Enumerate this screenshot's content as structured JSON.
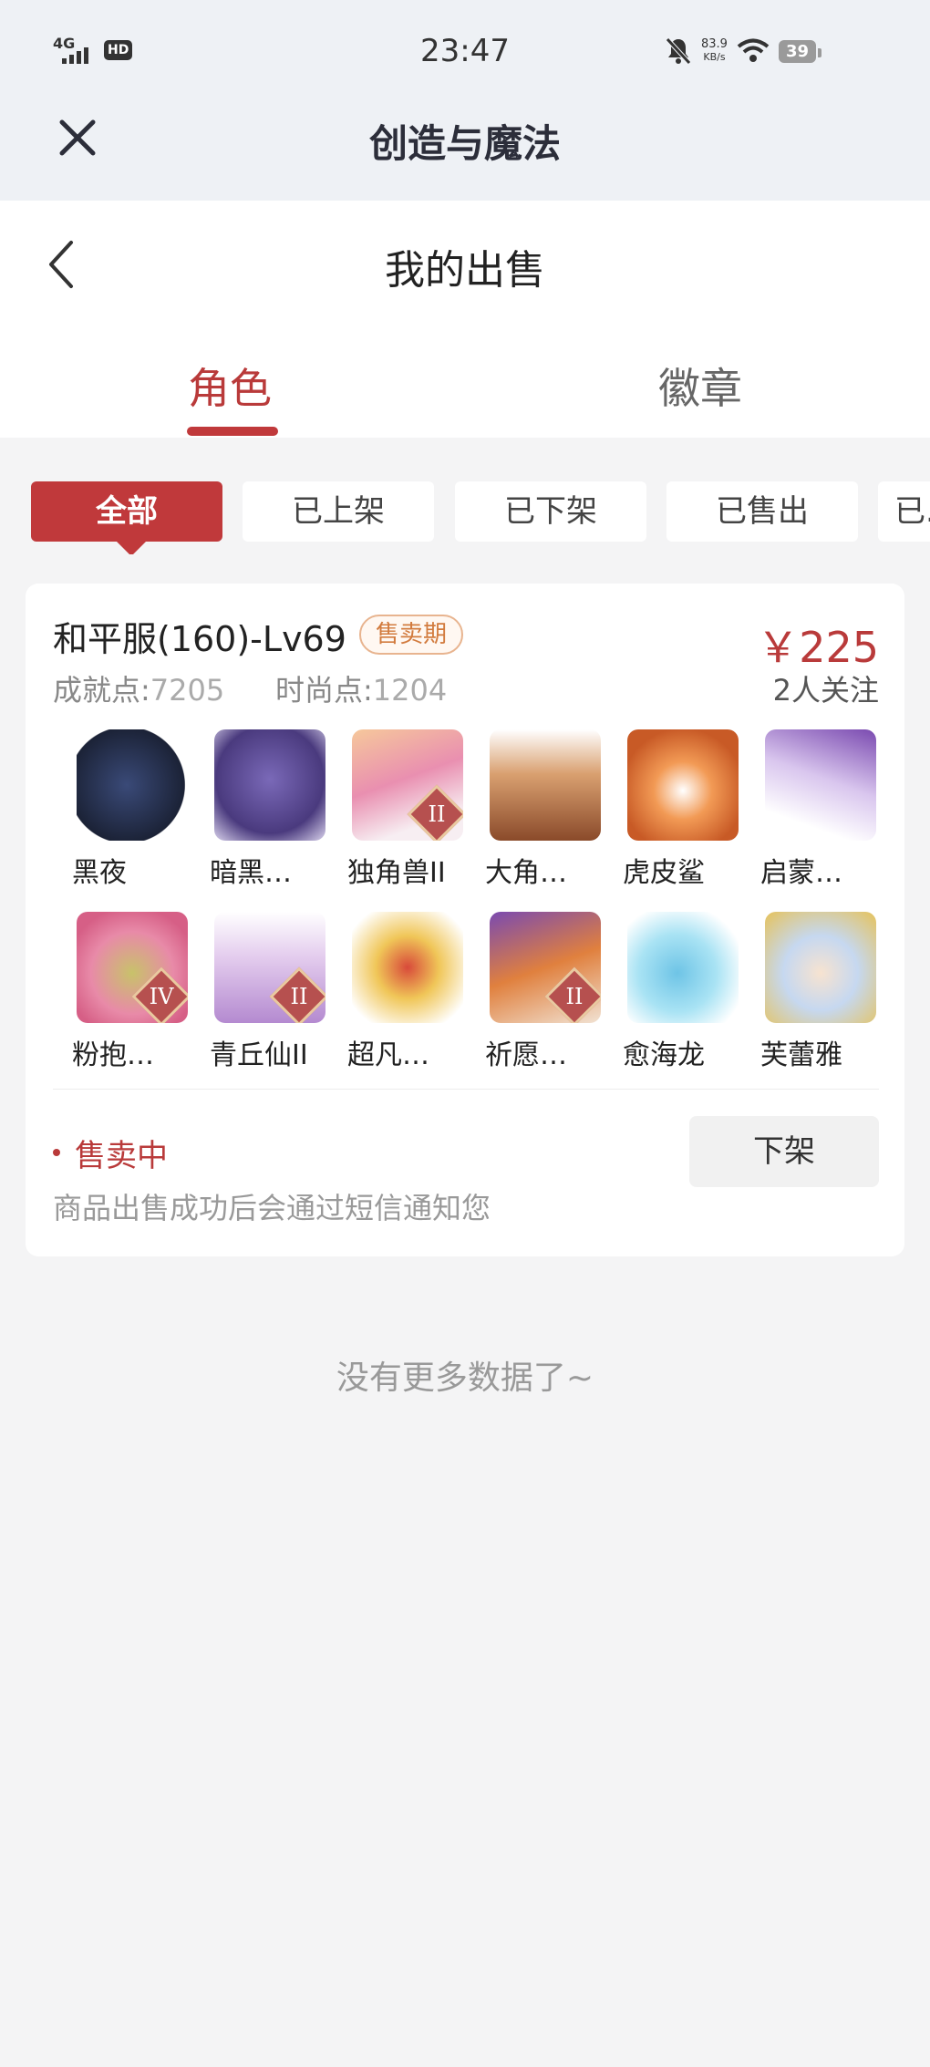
{
  "status_bar": {
    "time": "23:47",
    "network": "4G",
    "hd": "HD",
    "speed_value": "83.9",
    "speed_unit": "KB/s",
    "battery": "39"
  },
  "app": {
    "title": "创造与魔法",
    "close_icon": "close-icon"
  },
  "page": {
    "title": "我的出售",
    "back_icon": "chevron-left-icon"
  },
  "tabs": [
    {
      "label": "角色",
      "active": true
    },
    {
      "label": "徽章",
      "active": false
    }
  ],
  "filters": [
    "全部",
    "已上架",
    "已下架",
    "已售出",
    "已..."
  ],
  "listing": {
    "title": "和平服(160)-Lv69",
    "tag": "售卖期",
    "price": "￥225",
    "achievement_label": "成就点:",
    "achievement_value": "7205",
    "fashion_label": "时尚点:",
    "fashion_value": "1204",
    "followers": "2人关注",
    "pets": [
      {
        "name": "黑夜",
        "color": "#2b3552"
      },
      {
        "name": "暗黑…",
        "color": "#5a4a8e"
      },
      {
        "name": "独角兽II",
        "color": "#e79bb0",
        "badge": "II"
      },
      {
        "name": "大角…",
        "color": "#b5714a"
      },
      {
        "name": "虎皮鲨",
        "color": "#e2773a"
      },
      {
        "name": "启蒙…",
        "color": "#c9b3e6"
      },
      {
        "name": "粉抱…",
        "color": "#e07f9e",
        "badge": "IV"
      },
      {
        "name": "青丘仙II",
        "color": "#d9bfe6",
        "badge": "II"
      },
      {
        "name": "超凡…",
        "color": "#e7c35a"
      },
      {
        "name": "祈愿…",
        "color": "#c5653f",
        "badge": "II"
      },
      {
        "name": "愈海龙",
        "color": "#7fd0ea"
      },
      {
        "name": "芙蕾雅",
        "color": "#c6d8f0"
      }
    ],
    "status": "售卖中",
    "notice": "商品出售成功后会通过短信通知您",
    "delist_label": "下架"
  },
  "footer": {
    "no_more": "没有更多数据了~"
  },
  "colors": {
    "accent": "#c0393b",
    "tag_border": "#e8b48f",
    "background": "#f4f4f5"
  }
}
